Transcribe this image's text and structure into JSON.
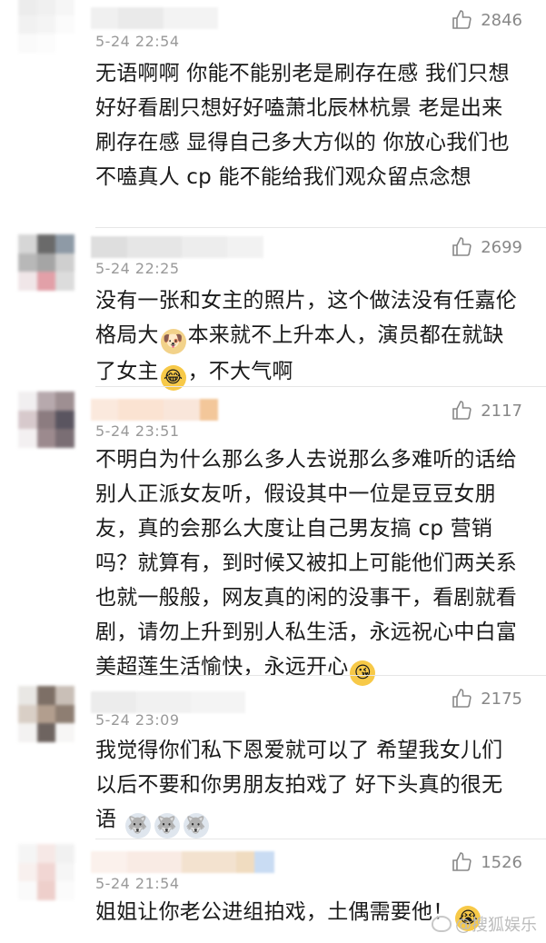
{
  "comments": [
    {
      "time": "5-24 22:54",
      "likes": "2846",
      "text": "无语啊啊 你能不能别老是刷存在感 我们只想好好看剧只想好好嗑萧北辰林杭景 老是出来刷存在感 显得自己多大方似的 你放心我们也不嗑真人 cp 能不能给我们观众留点念想"
    },
    {
      "time": "5-24 22:25",
      "likes": "2699",
      "text_parts": [
        "没有一张和女主的照片，这个做法没有任嘉伦格局大",
        "本来就不上升本人，演员都在就缺了女主",
        "，不大气啊"
      ],
      "emojis": [
        "doge-emoji",
        "laugh-cry-emoji"
      ]
    },
    {
      "time": "5-24 23:51",
      "likes": "2117",
      "text_parts": [
        "不明白为什么那么多人去说那么多难听的话给别人正派女友听，假设其中一位是豆豆女朋友，真的会那么大度让自己男友搞 cp 营销吗？就算有，到时候又被扣上可能他们两关系也就一般般，网友真的闲的没事干，看剧就看剧，请勿上升到别人私生活，永远祝心中白富美超莲生活愉快，永远开心"
      ],
      "emojis": [
        "heart-kiss-emoji"
      ]
    },
    {
      "time": "5-24 23:09",
      "likes": "2175",
      "text_parts": [
        "我觉得你们私下恩爱就可以了 希望我女儿们以后不要和你男朋友拍戏了 好下头真的很无语 "
      ],
      "emojis": [
        "husky-emoji",
        "husky-emoji",
        "husky-emoji"
      ]
    },
    {
      "time": "5-24 21:54",
      "likes": "1526",
      "text_parts": [
        "姐姐让你老公进组拍戏，土偶需要他！"
      ],
      "emojis": [
        "crying-emoji"
      ]
    }
  ],
  "watermark": "@搜狐娱乐",
  "colors": {
    "text": "#1a1a1a",
    "meta": "#999999",
    "divider": "#e6e6e6"
  }
}
